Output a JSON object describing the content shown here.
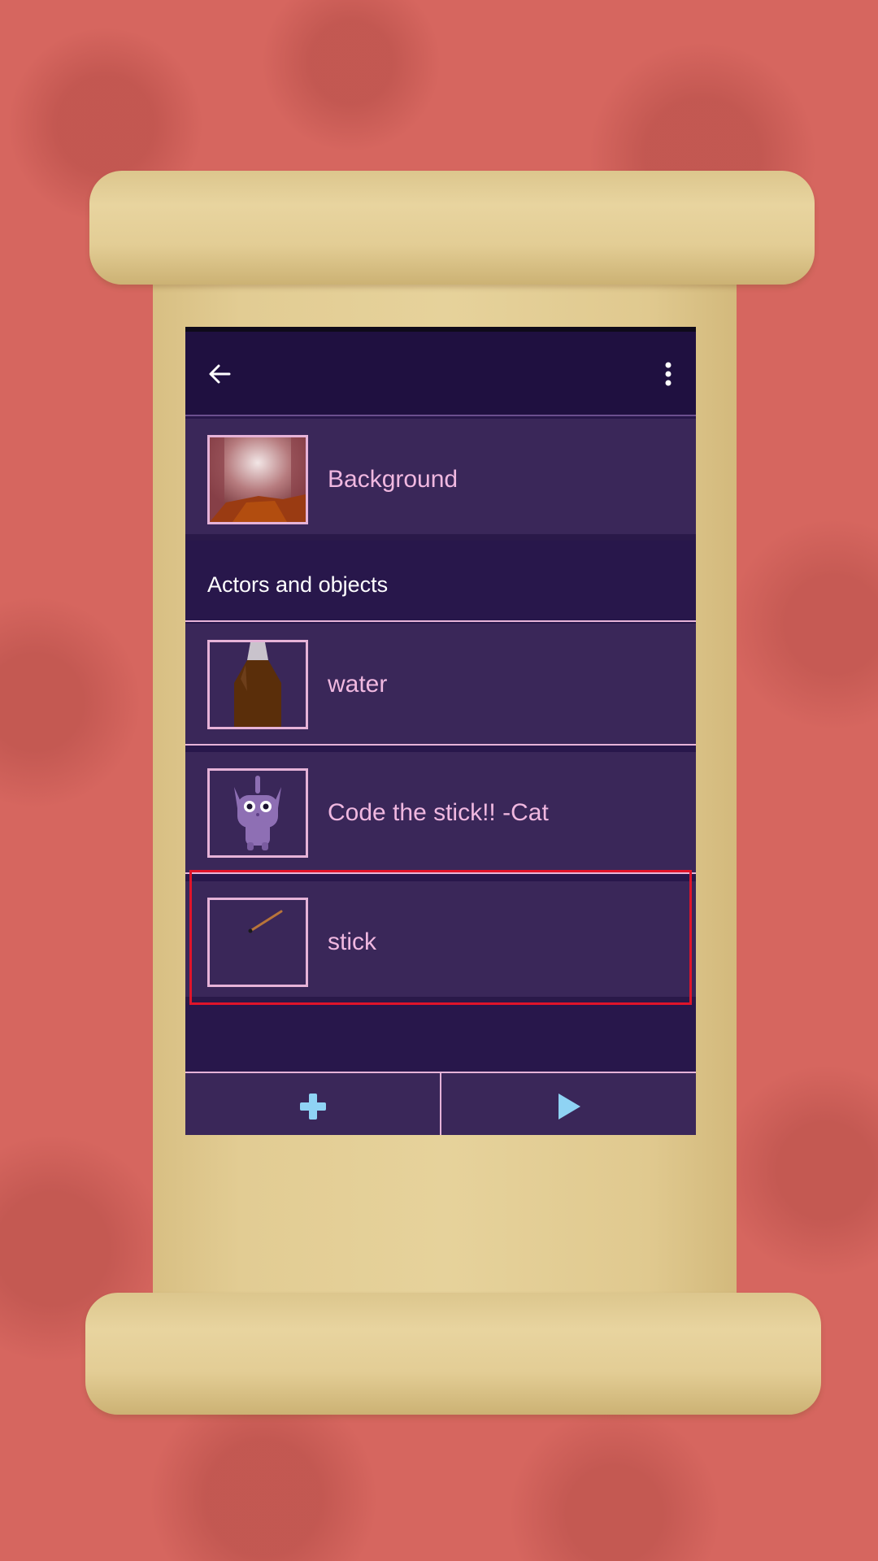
{
  "app": {
    "toolbar": {
      "back_icon": "arrow-left-icon",
      "menu_icon": "more-vertical-icon"
    },
    "background_item": {
      "label": "Background",
      "thumbnail": "background-thumbnail"
    },
    "section_header": "Actors and objects",
    "objects": [
      {
        "label": "water",
        "thumbnail": "bottle-thumbnail"
      },
      {
        "label": "Code the stick!! -Cat",
        "thumbnail": "cat-thumbnail"
      },
      {
        "label": "stick",
        "thumbnail": "stick-thumbnail",
        "highlighted": true
      }
    ],
    "bottom_bar": {
      "add_icon": "plus-icon",
      "play_icon": "play-icon"
    }
  },
  "colors": {
    "toolbar": "#1f1040",
    "row": "#3a2759",
    "text_accent": "#f0b8e0",
    "icon_accent": "#8fd3f4",
    "highlight": "#e0142a",
    "backdrop": "#d6665f"
  }
}
